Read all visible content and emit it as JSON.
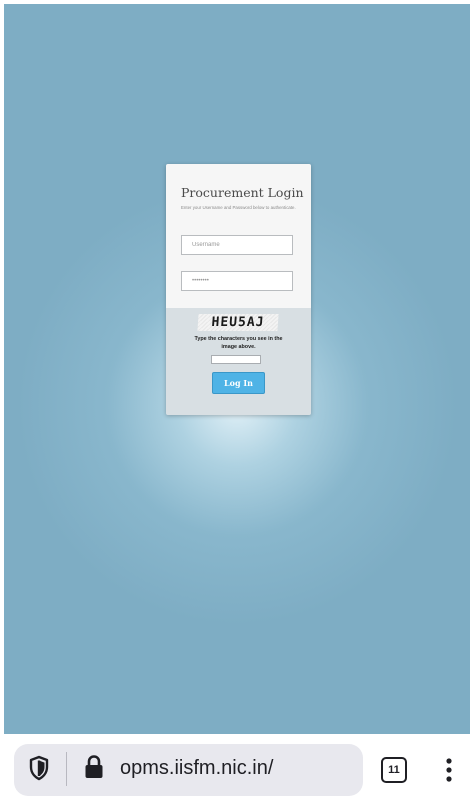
{
  "login": {
    "title": "Procurement Login",
    "subtitle": "Enter your Username and Password below to authenticate.",
    "username_placeholder": "Username",
    "password_placeholder": "••••••••",
    "captcha_text": "HEU5AJ",
    "captcha_instruction": "Type the characters you see in the image above.",
    "login_label": "Log In"
  },
  "browser": {
    "url": "opms.iisfm.nic.in/",
    "tab_count": "11"
  },
  "colors": {
    "background": "#7eadc4",
    "button": "#4fb3e6",
    "card_top": "#f6f6f6",
    "card_bottom": "#d8dfe3"
  },
  "icons": {
    "privacy": "shield-icon",
    "secure": "lock-icon",
    "tabs": "tab-switcher-icon",
    "menu": "more-vertical-icon"
  }
}
